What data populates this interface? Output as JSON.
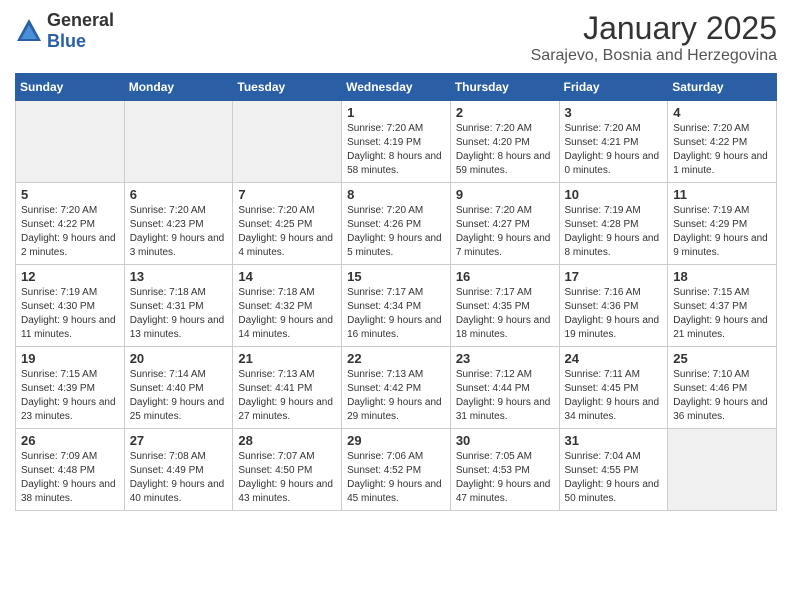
{
  "header": {
    "logo_general": "General",
    "logo_blue": "Blue",
    "month_title": "January 2025",
    "subtitle": "Sarajevo, Bosnia and Herzegovina"
  },
  "weekdays": [
    "Sunday",
    "Monday",
    "Tuesday",
    "Wednesday",
    "Thursday",
    "Friday",
    "Saturday"
  ],
  "weeks": [
    [
      {
        "day": "",
        "text": "",
        "shaded": true,
        "empty": true
      },
      {
        "day": "",
        "text": "",
        "shaded": true,
        "empty": true
      },
      {
        "day": "",
        "text": "",
        "shaded": true,
        "empty": true
      },
      {
        "day": "1",
        "text": "Sunrise: 7:20 AM\nSunset: 4:19 PM\nDaylight: 8 hours and 58 minutes."
      },
      {
        "day": "2",
        "text": "Sunrise: 7:20 AM\nSunset: 4:20 PM\nDaylight: 8 hours and 59 minutes."
      },
      {
        "day": "3",
        "text": "Sunrise: 7:20 AM\nSunset: 4:21 PM\nDaylight: 9 hours and 0 minutes."
      },
      {
        "day": "4",
        "text": "Sunrise: 7:20 AM\nSunset: 4:22 PM\nDaylight: 9 hours and 1 minute."
      }
    ],
    [
      {
        "day": "5",
        "text": "Sunrise: 7:20 AM\nSunset: 4:22 PM\nDaylight: 9 hours and 2 minutes."
      },
      {
        "day": "6",
        "text": "Sunrise: 7:20 AM\nSunset: 4:23 PM\nDaylight: 9 hours and 3 minutes."
      },
      {
        "day": "7",
        "text": "Sunrise: 7:20 AM\nSunset: 4:25 PM\nDaylight: 9 hours and 4 minutes."
      },
      {
        "day": "8",
        "text": "Sunrise: 7:20 AM\nSunset: 4:26 PM\nDaylight: 9 hours and 5 minutes."
      },
      {
        "day": "9",
        "text": "Sunrise: 7:20 AM\nSunset: 4:27 PM\nDaylight: 9 hours and 7 minutes."
      },
      {
        "day": "10",
        "text": "Sunrise: 7:19 AM\nSunset: 4:28 PM\nDaylight: 9 hours and 8 minutes."
      },
      {
        "day": "11",
        "text": "Sunrise: 7:19 AM\nSunset: 4:29 PM\nDaylight: 9 hours and 9 minutes."
      }
    ],
    [
      {
        "day": "12",
        "text": "Sunrise: 7:19 AM\nSunset: 4:30 PM\nDaylight: 9 hours and 11 minutes."
      },
      {
        "day": "13",
        "text": "Sunrise: 7:18 AM\nSunset: 4:31 PM\nDaylight: 9 hours and 13 minutes."
      },
      {
        "day": "14",
        "text": "Sunrise: 7:18 AM\nSunset: 4:32 PM\nDaylight: 9 hours and 14 minutes."
      },
      {
        "day": "15",
        "text": "Sunrise: 7:17 AM\nSunset: 4:34 PM\nDaylight: 9 hours and 16 minutes."
      },
      {
        "day": "16",
        "text": "Sunrise: 7:17 AM\nSunset: 4:35 PM\nDaylight: 9 hours and 18 minutes."
      },
      {
        "day": "17",
        "text": "Sunrise: 7:16 AM\nSunset: 4:36 PM\nDaylight: 9 hours and 19 minutes."
      },
      {
        "day": "18",
        "text": "Sunrise: 7:15 AM\nSunset: 4:37 PM\nDaylight: 9 hours and 21 minutes."
      }
    ],
    [
      {
        "day": "19",
        "text": "Sunrise: 7:15 AM\nSunset: 4:39 PM\nDaylight: 9 hours and 23 minutes."
      },
      {
        "day": "20",
        "text": "Sunrise: 7:14 AM\nSunset: 4:40 PM\nDaylight: 9 hours and 25 minutes."
      },
      {
        "day": "21",
        "text": "Sunrise: 7:13 AM\nSunset: 4:41 PM\nDaylight: 9 hours and 27 minutes."
      },
      {
        "day": "22",
        "text": "Sunrise: 7:13 AM\nSunset: 4:42 PM\nDaylight: 9 hours and 29 minutes."
      },
      {
        "day": "23",
        "text": "Sunrise: 7:12 AM\nSunset: 4:44 PM\nDaylight: 9 hours and 31 minutes."
      },
      {
        "day": "24",
        "text": "Sunrise: 7:11 AM\nSunset: 4:45 PM\nDaylight: 9 hours and 34 minutes."
      },
      {
        "day": "25",
        "text": "Sunrise: 7:10 AM\nSunset: 4:46 PM\nDaylight: 9 hours and 36 minutes."
      }
    ],
    [
      {
        "day": "26",
        "text": "Sunrise: 7:09 AM\nSunset: 4:48 PM\nDaylight: 9 hours and 38 minutes."
      },
      {
        "day": "27",
        "text": "Sunrise: 7:08 AM\nSunset: 4:49 PM\nDaylight: 9 hours and 40 minutes."
      },
      {
        "day": "28",
        "text": "Sunrise: 7:07 AM\nSunset: 4:50 PM\nDaylight: 9 hours and 43 minutes."
      },
      {
        "day": "29",
        "text": "Sunrise: 7:06 AM\nSunset: 4:52 PM\nDaylight: 9 hours and 45 minutes."
      },
      {
        "day": "30",
        "text": "Sunrise: 7:05 AM\nSunset: 4:53 PM\nDaylight: 9 hours and 47 minutes."
      },
      {
        "day": "31",
        "text": "Sunrise: 7:04 AM\nSunset: 4:55 PM\nDaylight: 9 hours and 50 minutes."
      },
      {
        "day": "",
        "text": "",
        "shaded": true,
        "empty": true
      }
    ]
  ]
}
